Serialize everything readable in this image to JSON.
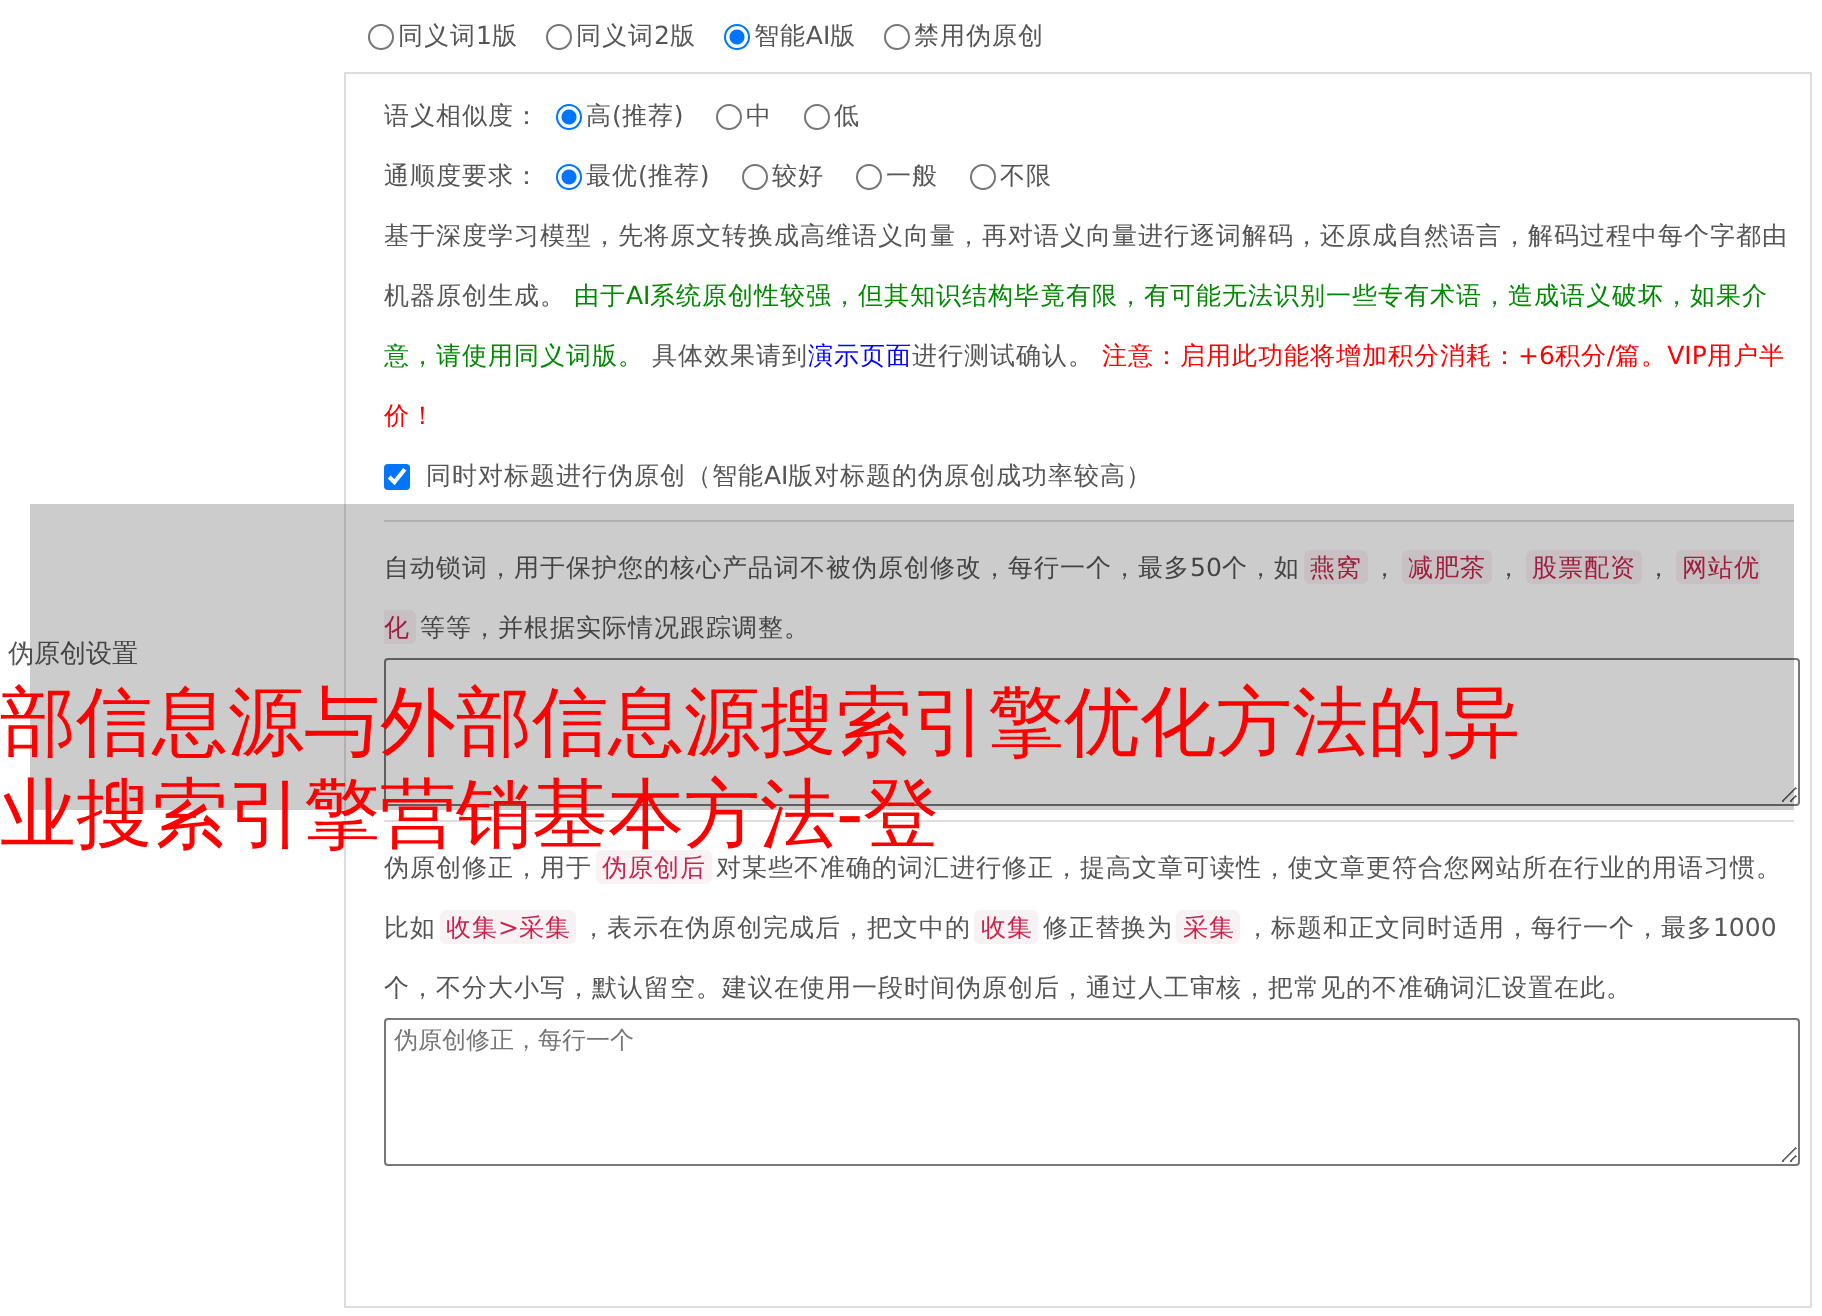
{
  "section_label": "伪原创设置",
  "mode_options": [
    {
      "label": "同义词1版",
      "selected": false
    },
    {
      "label": "同义词2版",
      "selected": false
    },
    {
      "label": "智能AI版",
      "selected": true
    },
    {
      "label": "禁用伪原创",
      "selected": false
    }
  ],
  "similarity": {
    "label": "语义相似度：",
    "options": [
      {
        "label": "高(推荐)",
        "selected": true
      },
      {
        "label": "中",
        "selected": false
      },
      {
        "label": "低",
        "selected": false
      }
    ]
  },
  "fluency": {
    "label": "通顺度要求：",
    "options": [
      {
        "label": "最优(推荐)",
        "selected": true
      },
      {
        "label": "较好",
        "selected": false
      },
      {
        "label": "一般",
        "selected": false
      },
      {
        "label": "不限",
        "selected": false
      }
    ]
  },
  "ai_description": [
    {
      "kind": "plain",
      "text": "基于深度学习模型，先将原文转换成高维语义向量，再对语义向量进行逐词解码，还原成自然语言，解码过程中每个字都由机器原创生成。 "
    },
    {
      "kind": "green",
      "text": "由于AI系统原创性较强，但其知识结构毕竟有限，有可能无法识别一些专有术语，造成语义破坏，如果介意，请使用同义词版。"
    },
    {
      "kind": "plain",
      "text": " 具体效果请到"
    },
    {
      "kind": "link",
      "text": "演示页面"
    },
    {
      "kind": "plain",
      "text": "进行测试确认。 "
    },
    {
      "kind": "red",
      "text": "注意：启用此功能将增加积分消耗：+6积分/篇。VIP用户半价！"
    }
  ],
  "title_checkbox": {
    "label": "同时对标题进行伪原创（智能AI版对标题的伪原创成功率较高）",
    "checked": true
  },
  "lock_words": {
    "description": [
      {
        "kind": "plain",
        "text": "自动锁词，用于保护您的核心产品词不被伪原创修改，每行一个，最多50个，如"
      },
      {
        "kind": "tag",
        "text": "燕窝"
      },
      {
        "kind": "plain",
        "text": "，"
      },
      {
        "kind": "tag",
        "text": "减肥茶"
      },
      {
        "kind": "plain",
        "text": "，"
      },
      {
        "kind": "tag",
        "text": "股票配资"
      },
      {
        "kind": "plain",
        "text": "，"
      },
      {
        "kind": "tag",
        "text": "网站优化"
      },
      {
        "kind": "plain",
        "text": "等等，并根据实际情况跟踪调整。"
      }
    ]
  },
  "correction": {
    "description": [
      {
        "kind": "plain",
        "text": "伪原创修正，用于"
      },
      {
        "kind": "tag",
        "text": "伪原创后"
      },
      {
        "kind": "plain",
        "text": "对某些不准确的词汇进行修正，提高文章可读性，使文章更符合您网站所在行业的用语习惯。比如"
      },
      {
        "kind": "tag",
        "text": "收集>采集"
      },
      {
        "kind": "plain",
        "text": "，表示在伪原创完成后，把文中的"
      },
      {
        "kind": "tag",
        "text": "收集"
      },
      {
        "kind": "plain",
        "text": "修正替换为"
      },
      {
        "kind": "tag",
        "text": "采集"
      },
      {
        "kind": "plain",
        "text": "，标题和正文同时适用，每行一个，最多1000个，不分大小写，默认留空。建议在使用一段时间伪原创后，通过人工审核，把常见的不准确词汇设置在此。"
      }
    ],
    "placeholder": "伪原创修正，每行一个"
  },
  "overlay_title": [
    "部信息源与外部信息源搜索引擎优化方法的异",
    "业搜索引擎营销基本方法-登"
  ]
}
